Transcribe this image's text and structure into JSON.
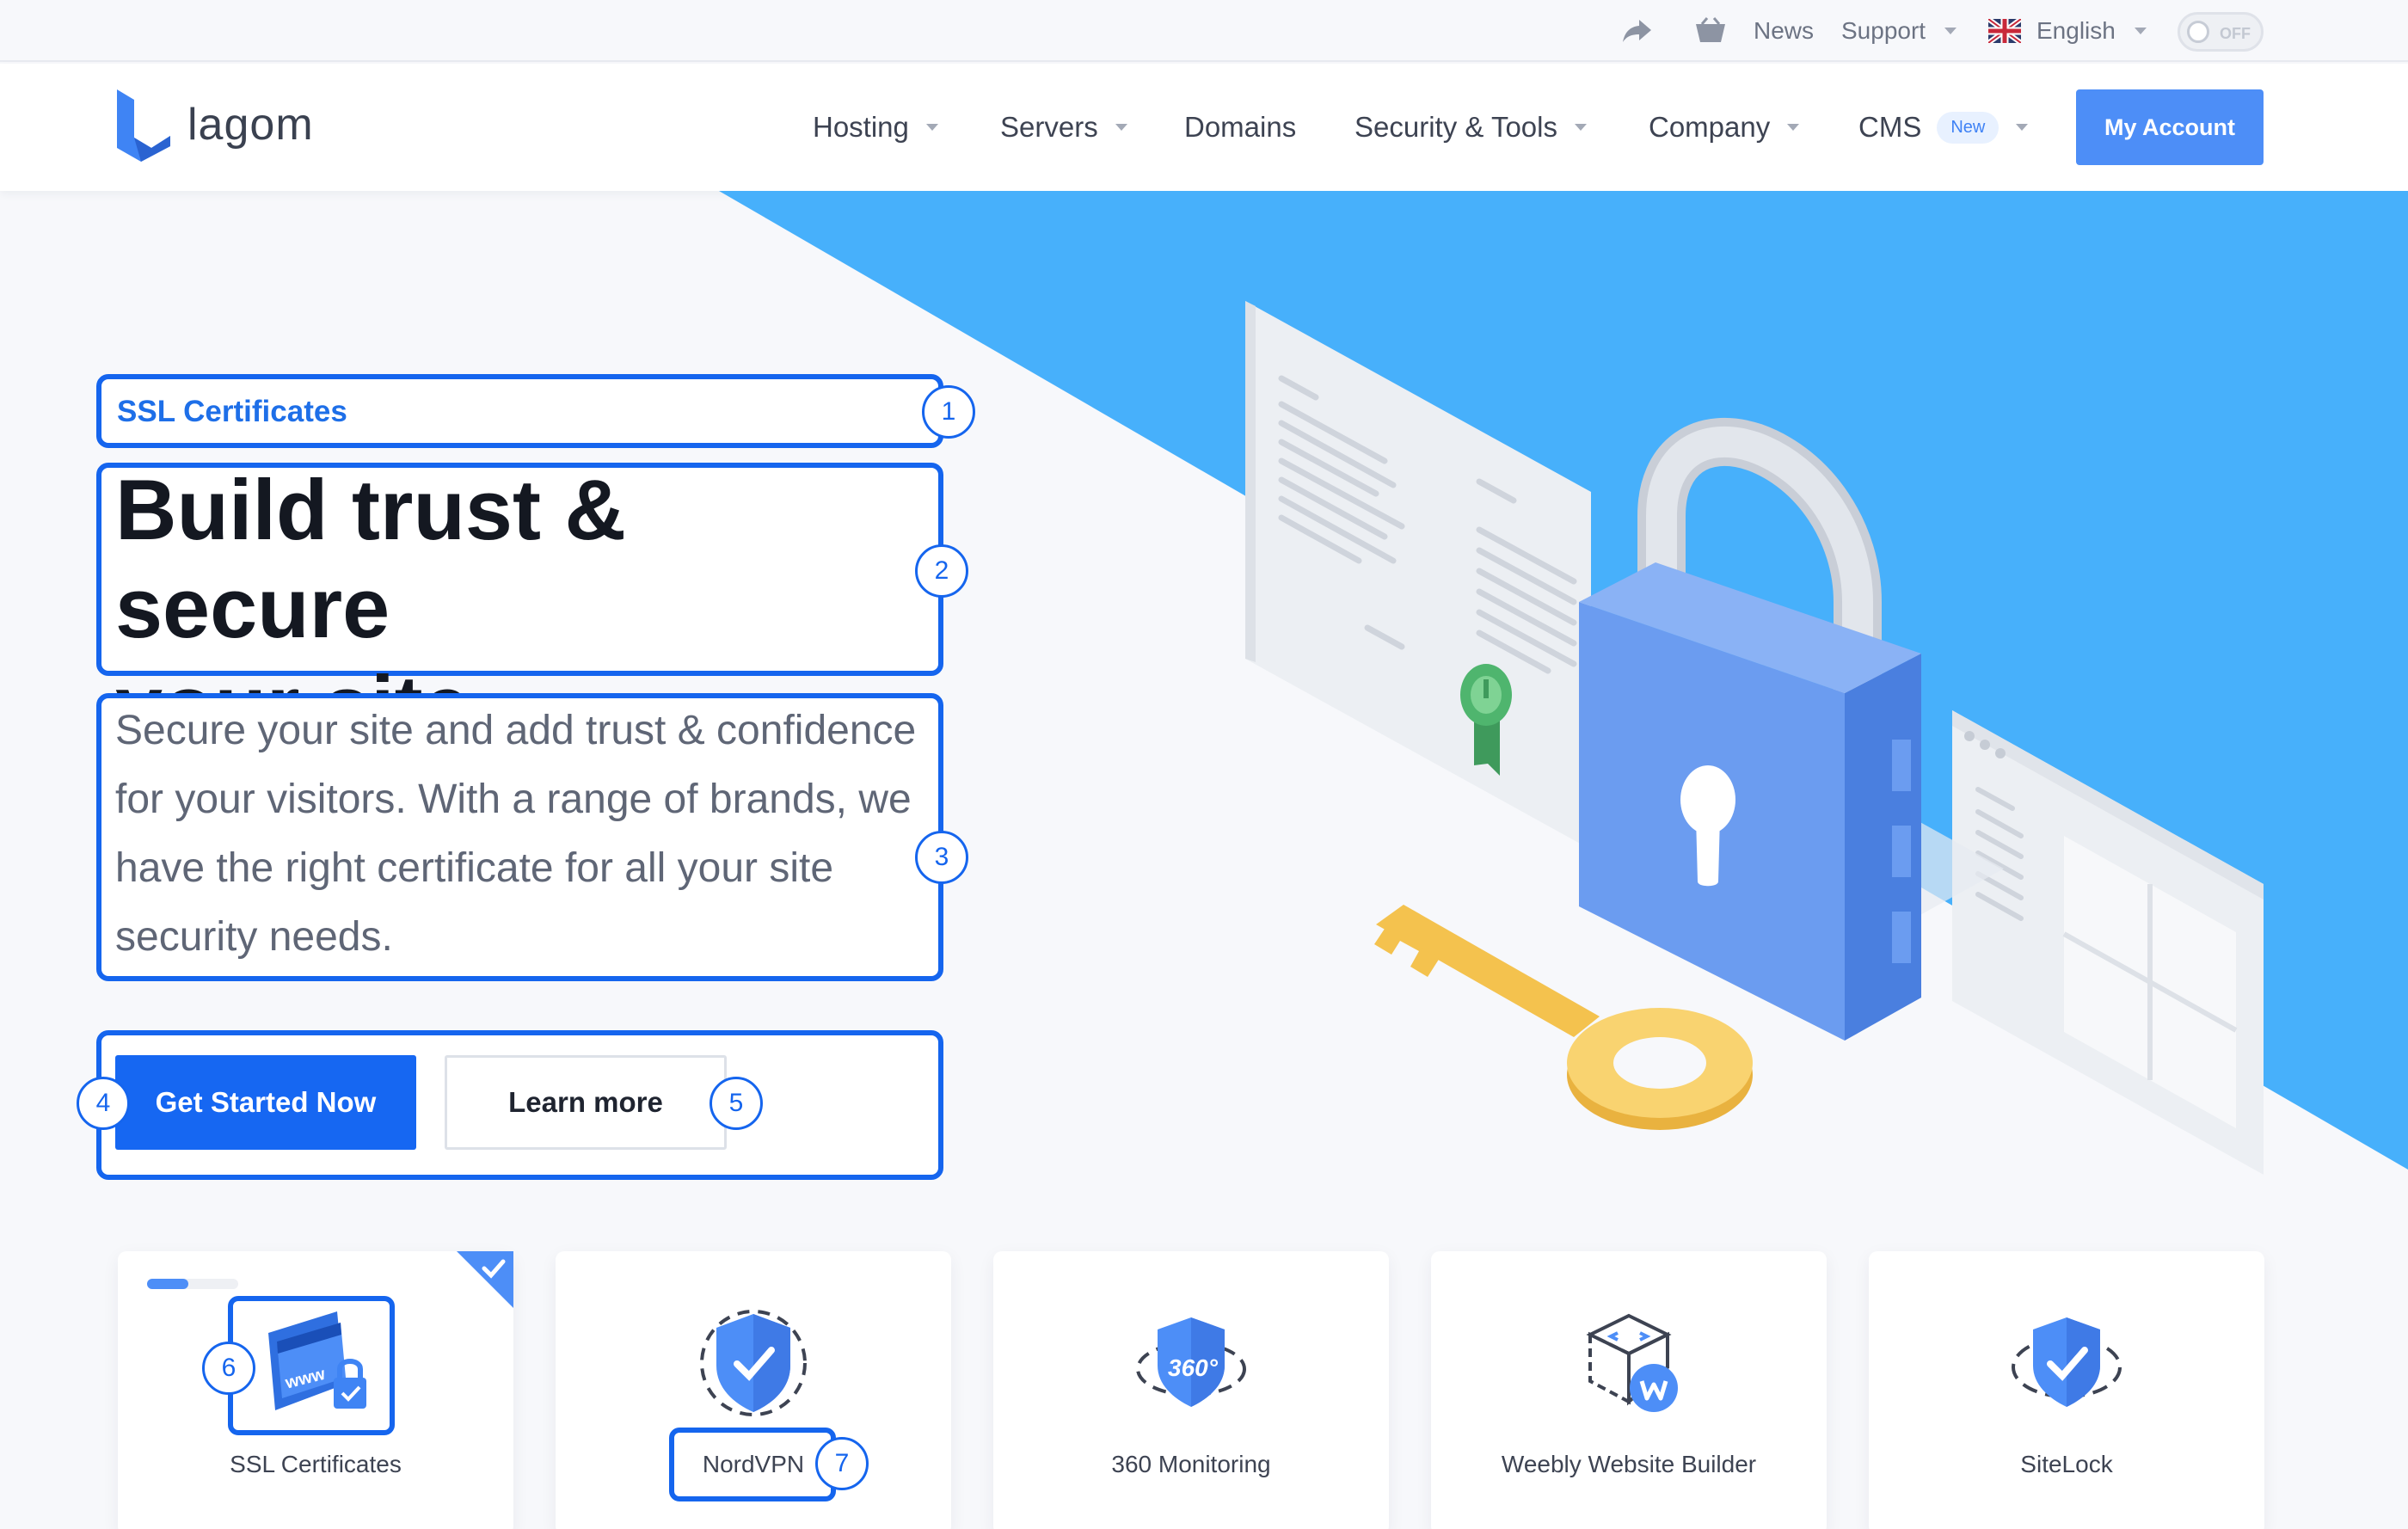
{
  "topbar": {
    "news": "News",
    "support": "Support",
    "language": "English",
    "theme_toggle": "OFF"
  },
  "nav": {
    "logo": "lagom",
    "items": [
      {
        "label": "Hosting",
        "dropdown": true
      },
      {
        "label": "Servers",
        "dropdown": true
      },
      {
        "label": "Domains",
        "dropdown": false
      },
      {
        "label": "Security & Tools",
        "dropdown": true
      },
      {
        "label": "Company",
        "dropdown": true
      },
      {
        "label": "CMS",
        "dropdown": true,
        "badge": "New"
      }
    ],
    "account_button": "My Account"
  },
  "hero": {
    "eyebrow": "SSL Certificates",
    "headline_line1": "Build trust & secure",
    "headline_line2": "your site",
    "lead_lines": [
      "Secure your site and add trust & confidence",
      "for your visitors. With a range of brands, we",
      "have the right certificate for all your site",
      "security needs."
    ],
    "primary_button": "Get Started Now",
    "secondary_button": "Learn more"
  },
  "annotations": [
    "1",
    "2",
    "3",
    "4",
    "5",
    "6",
    "7"
  ],
  "cards": [
    {
      "label": "SSL Certificates",
      "icon": "ssl-certificate-icon",
      "selected": true,
      "progress": 0.45
    },
    {
      "label": "NordVPN",
      "icon": "nordvpn-shield-icon"
    },
    {
      "label": "360 Monitoring",
      "icon": "monitoring-360-icon"
    },
    {
      "label": "Weebly Website Builder",
      "icon": "weebly-builder-icon"
    },
    {
      "label": "SiteLock",
      "icon": "sitelock-shield-icon"
    }
  ],
  "colors": {
    "brand": "#4d8ef7",
    "primary": "#1667f2",
    "annotation": "#1565ee",
    "hero_blue": "#47b0fb"
  }
}
